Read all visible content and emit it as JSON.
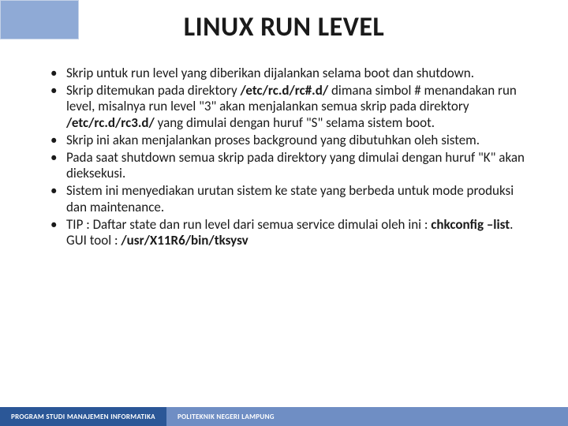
{
  "title": "LINUX RUN LEVEL",
  "footer": {
    "left": "PROGRAM STUDI MANAJEMEN INFORMATIKA",
    "right": "POLITEKNIK NEGERI LAMPUNG"
  },
  "bullets": [
    {
      "text": "Skrip untuk run level yang diberikan dijalankan selama boot dan shutdown."
    },
    {
      "segments": [
        {
          "t": "Skrip ditemukan pada direktory "
        },
        {
          "t": "/etc/rc.d/rc#.d/",
          "bold": true
        },
        {
          "t": " dimana simbol # menandakan run level, misalnya run level \"3\" akan menjalankan semua skrip pada direktory "
        },
        {
          "t": "/etc/rc.d/rc3.d/",
          "bold": true
        },
        {
          "t": " yang dimulai dengan huruf \"S\" selama sistem boot."
        }
      ]
    },
    {
      "text": "Skrip ini akan menjalankan proses background yang dibutuhkan oleh sistem."
    },
    {
      "text": "Pada saat shutdown semua skrip pada direktory yang dimulai dengan huruf \"K\" akan dieksekusi."
    },
    {
      "text": "Sistem ini menyediakan urutan sistem ke state yang berbeda untuk mode produksi dan maintenance."
    },
    {
      "segments": [
        {
          "t": "TIP : Daftar state dan run level dari semua service dimulai oleh ini : "
        },
        {
          "t": "chkconfig –list",
          "bold": true
        },
        {
          "t": ". GUI tool : "
        },
        {
          "t": "/usr/X11R6/bin/tksysv",
          "bold": true
        }
      ]
    }
  ]
}
